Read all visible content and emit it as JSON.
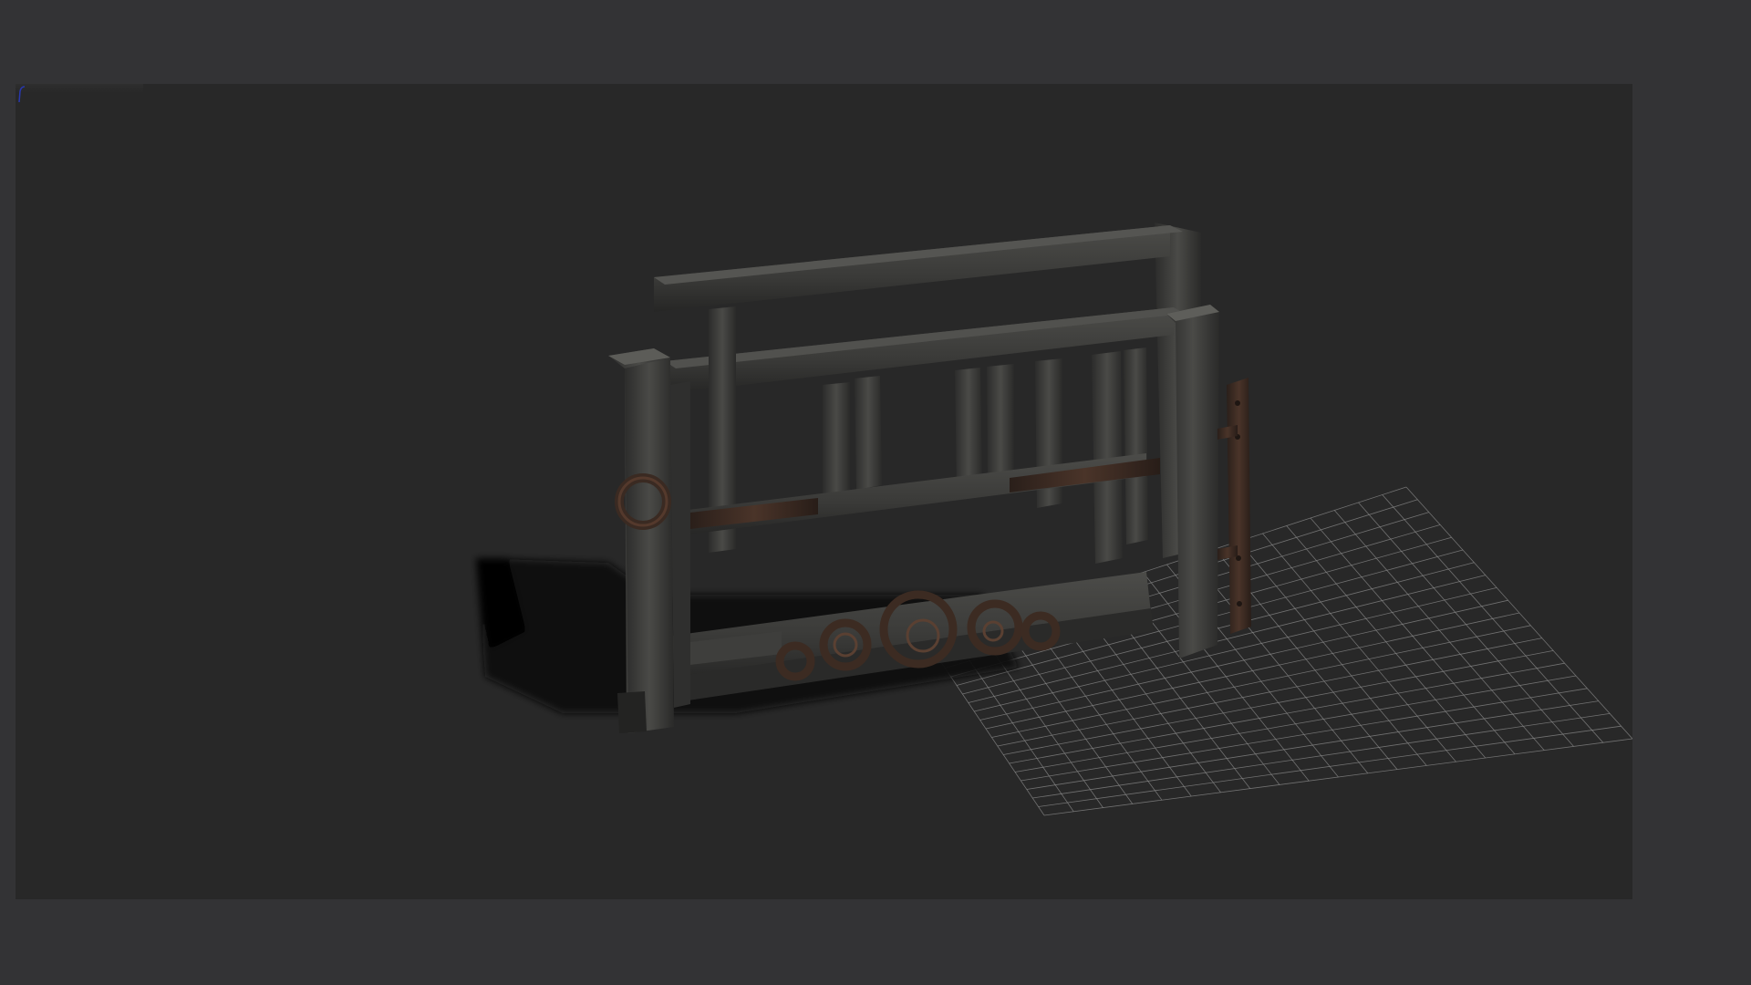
{
  "app": {
    "background_color": "#333335"
  },
  "viewport": {
    "background_color": "#282828",
    "grid": {
      "visible": true,
      "color": "#8a8a8a"
    },
    "model": {
      "type": "wooden gate",
      "wood_color": "#3c3c3a",
      "iron_color": "#3a2a22"
    },
    "axis_indicator": {
      "icon": "axis-gizmo-icon",
      "color": "#2838b0"
    }
  }
}
